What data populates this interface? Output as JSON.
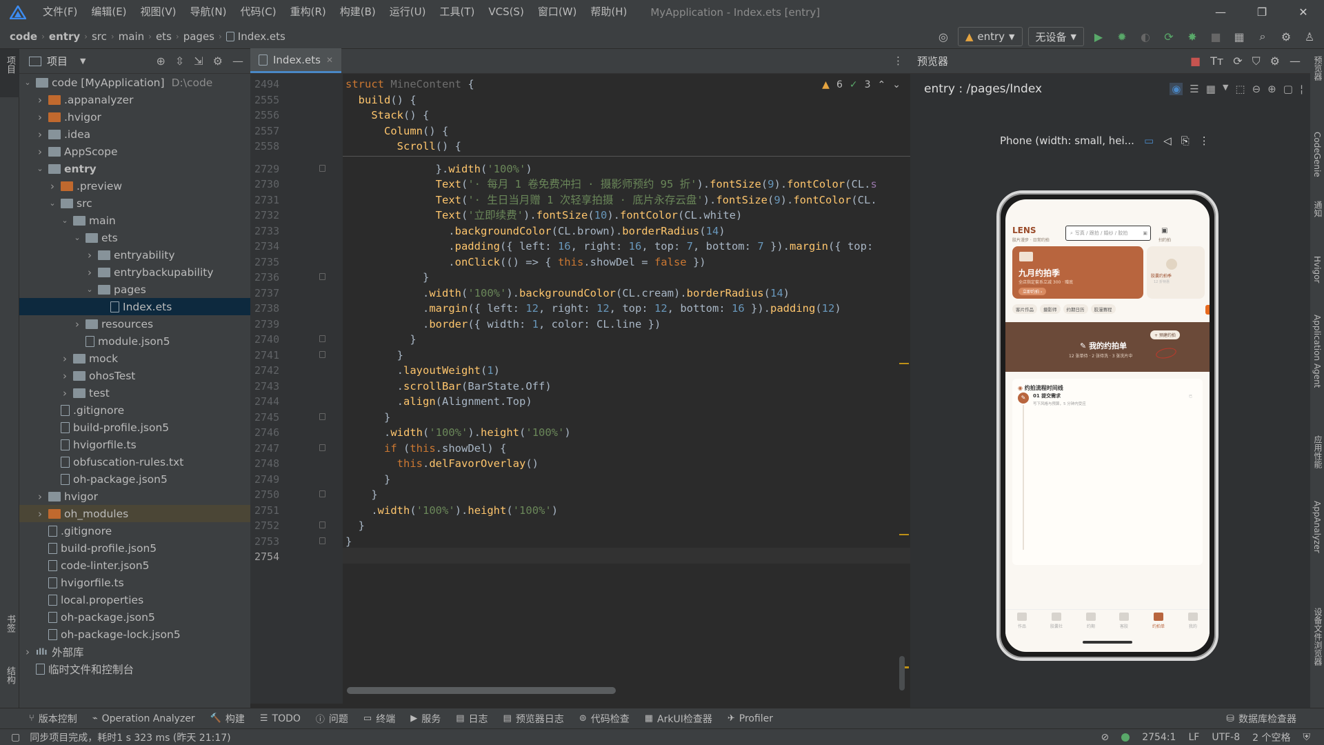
{
  "menubar": {
    "items": [
      "文件(F)",
      "编辑(E)",
      "视图(V)",
      "导航(N)",
      "代码(C)",
      "重构(R)",
      "构建(B)",
      "运行(U)",
      "工具(T)",
      "VCS(S)",
      "窗口(W)",
      "帮助(H)"
    ],
    "window_title": "MyApplication - Index.ets [entry]"
  },
  "breadcrumb": [
    "code",
    "entry",
    "src",
    "main",
    "ets",
    "pages",
    "Index.ets"
  ],
  "toolbar": {
    "run_config": "entry",
    "device": "无设备"
  },
  "project_panel": {
    "title": "项目",
    "tree": [
      {
        "label": "code [MyApplication]",
        "extra": "D:\\code",
        "depth": 0,
        "open": true,
        "icon": "folder"
      },
      {
        "label": ".appanalyzer",
        "depth": 1,
        "open": false,
        "icon": "orange"
      },
      {
        "label": ".hvigor",
        "depth": 1,
        "open": false,
        "icon": "orange"
      },
      {
        "label": ".idea",
        "depth": 1,
        "open": false,
        "icon": "folder"
      },
      {
        "label": "AppScope",
        "depth": 1,
        "open": false,
        "icon": "folder"
      },
      {
        "label": "entry",
        "depth": 1,
        "open": true,
        "icon": "folder",
        "bold": true
      },
      {
        "label": ".preview",
        "depth": 2,
        "open": false,
        "icon": "orange"
      },
      {
        "label": "src",
        "depth": 2,
        "open": true,
        "icon": "folder"
      },
      {
        "label": "main",
        "depth": 3,
        "open": true,
        "icon": "folder"
      },
      {
        "label": "ets",
        "depth": 4,
        "open": true,
        "icon": "folder"
      },
      {
        "label": "entryability",
        "depth": 5,
        "open": false,
        "icon": "folder"
      },
      {
        "label": "entrybackupability",
        "depth": 5,
        "open": false,
        "icon": "folder"
      },
      {
        "label": "pages",
        "depth": 5,
        "open": true,
        "icon": "folder"
      },
      {
        "label": "Index.ets",
        "depth": 6,
        "icon": "file",
        "selected": true
      },
      {
        "label": "resources",
        "depth": 4,
        "open": false,
        "icon": "folder"
      },
      {
        "label": "module.json5",
        "depth": 4,
        "icon": "file"
      },
      {
        "label": "mock",
        "depth": 3,
        "open": false,
        "icon": "folder"
      },
      {
        "label": "ohosTest",
        "depth": 3,
        "open": false,
        "icon": "folder"
      },
      {
        "label": "test",
        "depth": 3,
        "open": false,
        "icon": "folder"
      },
      {
        "label": ".gitignore",
        "depth": 2,
        "icon": "file"
      },
      {
        "label": "build-profile.json5",
        "depth": 2,
        "icon": "file"
      },
      {
        "label": "hvigorfile.ts",
        "depth": 2,
        "icon": "file"
      },
      {
        "label": "obfuscation-rules.txt",
        "depth": 2,
        "icon": "file"
      },
      {
        "label": "oh-package.json5",
        "depth": 2,
        "icon": "file"
      },
      {
        "label": "hvigor",
        "depth": 1,
        "open": false,
        "icon": "folder"
      },
      {
        "label": "oh_modules",
        "depth": 1,
        "open": false,
        "icon": "orange",
        "highlight": true
      },
      {
        "label": ".gitignore",
        "depth": 1,
        "icon": "file"
      },
      {
        "label": "build-profile.json5",
        "depth": 1,
        "icon": "file"
      },
      {
        "label": "code-linter.json5",
        "depth": 1,
        "icon": "file"
      },
      {
        "label": "hvigorfile.ts",
        "depth": 1,
        "icon": "file"
      },
      {
        "label": "local.properties",
        "depth": 1,
        "icon": "file"
      },
      {
        "label": "oh-package.json5",
        "depth": 1,
        "icon": "file"
      },
      {
        "label": "oh-package-lock.json5",
        "depth": 1,
        "icon": "file"
      },
      {
        "label": "外部库",
        "depth": 0,
        "open": false,
        "icon": "bars"
      },
      {
        "label": "临时文件和控制台",
        "depth": 0,
        "icon": "file"
      }
    ]
  },
  "editor": {
    "tab": "Index.ets",
    "inspections": {
      "warnings": "6",
      "weak_warnings": "3"
    },
    "sticky_lines": [
      {
        "num": "2494",
        "html": "<span class='k'>struct</span> <span style='color:#6e6e6e'>MineContent</span> {"
      },
      {
        "num": "2555",
        "html": "  <span class='f'>build</span>() {"
      },
      {
        "num": "2556",
        "html": "    <span class='f'>Stack</span>() {"
      },
      {
        "num": "2557",
        "html": "      <span class='f'>Column</span>() {"
      },
      {
        "num": "2558",
        "html": "        <span class='f'>Scroll</span>() {"
      }
    ],
    "lines": [
      {
        "num": "2729",
        "html": "              }.<span class='f'>width</span>(<span class='s'>'100%'</span>)"
      },
      {
        "num": "2730",
        "html": "              <span class='f'>Text</span>(<span class='s'>'· 每月 1 卷免费冲扫 · 摄影师预约 95 折'</span>).<span class='f'>fontSize</span>(<span class='n'>9</span>).<span class='f'>fontColor</span>(CL.<span class='p'>s</span>"
      },
      {
        "num": "2731",
        "html": "              <span class='f'>Text</span>(<span class='s'>'· 生日当月赠 1 次轻享拍摄 · 底片永存云盘'</span>).<span class='f'>fontSize</span>(<span class='n'>9</span>).<span class='f'>fontColor</span>(CL."
      },
      {
        "num": "2732",
        "html": "              <span class='f'>Text</span>(<span class='s'>'立即续费'</span>).<span class='f'>fontSize</span>(<span class='n'>10</span>).<span class='f'>fontColor</span>(CL.white)"
      },
      {
        "num": "2733",
        "html": "                .<span class='f'>backgroundColor</span>(CL.brown).<span class='f'>borderRadius</span>(<span class='n'>14</span>)"
      },
      {
        "num": "2734",
        "html": "                .<span class='f'>padding</span>({ left: <span class='n'>16</span>, right: <span class='n'>16</span>, top: <span class='n'>7</span>, bottom: <span class='n'>7</span> }).<span class='f'>margin</span>({ top:"
      },
      {
        "num": "2735",
        "html": "                .<span class='f'>onClick</span>(() => { <span class='k'>this</span>.showDel = <span class='k'>false</span> })"
      },
      {
        "num": "2736",
        "html": "            }"
      },
      {
        "num": "2737",
        "html": "            .<span class='f'>width</span>(<span class='s'>'100%'</span>).<span class='f'>backgroundColor</span>(CL.cream).<span class='f'>borderRadius</span>(<span class='n'>14</span>)"
      },
      {
        "num": "2738",
        "html": "            .<span class='f'>margin</span>({ left: <span class='n'>12</span>, right: <span class='n'>12</span>, top: <span class='n'>12</span>, bottom: <span class='n'>16</span> }).<span class='f'>padding</span>(<span class='n'>12</span>)"
      },
      {
        "num": "2739",
        "html": "            .<span class='f'>border</span>({ width: <span class='n'>1</span>, color: CL.line })"
      },
      {
        "num": "2740",
        "html": "          }"
      },
      {
        "num": "2741",
        "html": "        }"
      },
      {
        "num": "2742",
        "html": "        .<span class='f'>layoutWeight</span>(<span class='n'>1</span>)"
      },
      {
        "num": "2743",
        "html": "        .<span class='f'>scrollBar</span>(BarState.Off)"
      },
      {
        "num": "2744",
        "html": "        .<span class='f'>align</span>(Alignment.Top)"
      },
      {
        "num": "2745",
        "html": "      }"
      },
      {
        "num": "2746",
        "html": "      .<span class='f'>width</span>(<span class='s'>'100%'</span>).<span class='f'>height</span>(<span class='s'>'100%'</span>)"
      },
      {
        "num": "2747",
        "html": "      <span class='k'>if</span> (<span class='k'>this</span>.showDel) {"
      },
      {
        "num": "2748",
        "html": "        <span class='k'>this</span>.<span class='f'>delFavorOverlay</span>()"
      },
      {
        "num": "2749",
        "html": "      }"
      },
      {
        "num": "2750",
        "html": "    }"
      },
      {
        "num": "2751",
        "html": "    .<span class='f'>width</span>(<span class='s'>'100%'</span>).<span class='f'>height</span>(<span class='s'>'100%'</span>)"
      },
      {
        "num": "2752",
        "html": "  }"
      },
      {
        "num": "2753",
        "html": "}"
      },
      {
        "num": "2754",
        "html": ""
      }
    ]
  },
  "previewer": {
    "title": "预览器",
    "route": "entry : /pages/Index",
    "device": "Phone (width: small, hei...",
    "app": {
      "brand": "LENS",
      "brand_sub": "胶片漫步 · 日常约拍",
      "search": "写真 / 跟拍 / 婚纱 / 胶拍",
      "scan_label": "扫约拍",
      "banner_title": "九月约拍季",
      "banner_sub": "全店指定套系立减 300 · 赠底",
      "banner_btn": "立即约拍 ›",
      "side_card": "胶囊约拍季",
      "side_card_sub": "12 折特惠",
      "chips": [
        "客片作品",
        "摄影师",
        "约期日历",
        "胶漫赛程"
      ],
      "order_title": "我的约拍单",
      "order_btn": "+ 预建约拍",
      "order_sub": "12 张单待 · 2 张待洗 · 3 张洗片中",
      "timeline_title": "约拍流程时间线",
      "timeline_step": "01 提交需求",
      "timeline_desc": "写下风格与预算，5 分钟内受应",
      "timeline_tag": "已",
      "nav": [
        "作品",
        "胶囊社",
        "约期",
        "客胶",
        "约拍单",
        "我的"
      ]
    }
  },
  "bottom_tools": [
    "版本控制",
    "Operation Analyzer",
    "构建",
    "TODO",
    "问题",
    "终端",
    "服务",
    "日志",
    "预览器日志",
    "代码检查",
    "ArkUI检查器",
    "Profiler"
  ],
  "bottom_right": "数据库检查器",
  "status": {
    "message": "同步项目完成，耗时1 s 323 ms (昨天 21:17)",
    "position": "2754:1",
    "line_sep": "LF",
    "encoding": "UTF-8",
    "indent": "2 个空格"
  },
  "left_strip": [
    "项目",
    "书签",
    "结构"
  ],
  "right_strip": [
    "预览器",
    "CodeGenie",
    "通知",
    "Hvigor",
    "Application Agent",
    "应用性能",
    "AppAnalyzer",
    "设备文件浏览器"
  ],
  "colors": {
    "accent": "#4a88c7",
    "brown": "#b8653e",
    "dark_card": "#6b4a39"
  }
}
